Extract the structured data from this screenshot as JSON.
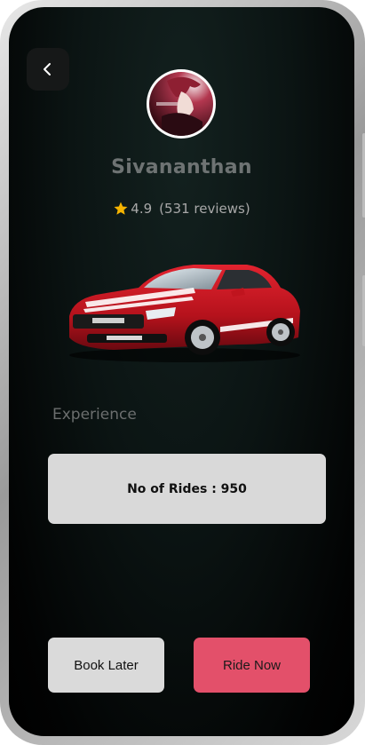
{
  "profile": {
    "name": "Sivananthan",
    "rating": "4.9",
    "reviews": "(531 reviews)"
  },
  "icons": {
    "back": "chevron-left-icon",
    "star": "star-icon",
    "car": "red-sports-car"
  },
  "experience": {
    "title": "Experience",
    "rides_text": "No of Rides : 950"
  },
  "actions": {
    "book_later": "Book Later",
    "ride_now": "Ride Now"
  },
  "colors": {
    "accent": "#e3506a",
    "card": "#d9d9d9",
    "star": "#f5b301"
  }
}
